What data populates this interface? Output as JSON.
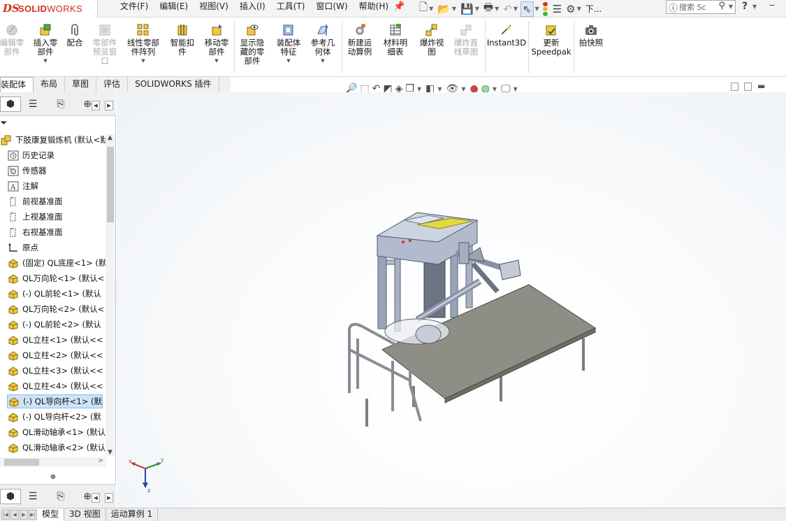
{
  "app": {
    "brand_ds": "DS",
    "brand_name_bold": "SOLID",
    "brand_name_light": "WORKS",
    "brand_color": "#d52b1e"
  },
  "menu": [
    "文件(F)",
    "编辑(E)",
    "视图(V)",
    "插入(I)",
    "工具(T)",
    "窗口(W)",
    "帮助(H)"
  ],
  "quick_access": {
    "search_placeholder": "搜索 Sc",
    "truncated_label": "下..."
  },
  "commands": [
    {
      "label": "编辑零\n部件",
      "disabled": true
    },
    {
      "label": "插入零\n部件",
      "disabled": false
    },
    {
      "label": "配合",
      "disabled": false
    },
    {
      "label": "零部件\n预览窗\n口",
      "disabled": true
    },
    {
      "label": "线性零部\n件阵列",
      "disabled": false
    },
    {
      "label": "智能扣\n件",
      "disabled": false
    },
    {
      "label": "移动零\n部件",
      "disabled": false
    },
    {
      "label": "显示隐\n藏的零\n部件",
      "disabled": false
    },
    {
      "label": "装配体\n特征",
      "disabled": false
    },
    {
      "label": "参考几\n何体",
      "disabled": false
    },
    {
      "label": "新建运\n动算例",
      "disabled": false
    },
    {
      "label": "材料明\n细表",
      "disabled": false
    },
    {
      "label": "爆炸视\n图",
      "disabled": false
    },
    {
      "label": "爆炸直\n线草图",
      "disabled": true
    },
    {
      "label": "Instant3D",
      "disabled": false
    },
    {
      "label": "更新\nSpeedpak",
      "disabled": false
    },
    {
      "label": "拍快照",
      "disabled": false
    }
  ],
  "command_tabs": [
    "装配体",
    "布局",
    "草图",
    "评估",
    "SOLIDWORKS 插件"
  ],
  "tree": {
    "root": "下肢康复锻炼机  (默认<默",
    "items": [
      {
        "label": "历史记录",
        "icon": "history-icon"
      },
      {
        "label": "传感器",
        "icon": "sensor-icon"
      },
      {
        "label": "注解",
        "icon": "annotation-icon"
      },
      {
        "label": "前视基准面",
        "icon": "plane-icon"
      },
      {
        "label": "上视基准面",
        "icon": "plane-icon"
      },
      {
        "label": "右视基准面",
        "icon": "plane-icon"
      },
      {
        "label": "原点",
        "icon": "origin-icon"
      },
      {
        "label": "(固定) QL底座<1>  (默",
        "icon": "part-icon"
      },
      {
        "label": "QL万向轮<1>  (默认<",
        "icon": "part-icon"
      },
      {
        "label": "(-) QL前轮<1>  (默认",
        "icon": "part-icon"
      },
      {
        "label": "QL万向轮<2>  (默认<",
        "icon": "part-icon"
      },
      {
        "label": "(-) QL前轮<2>  (默认",
        "icon": "part-icon"
      },
      {
        "label": "QL立柱<1>  (默认<<",
        "icon": "part-icon"
      },
      {
        "label": "QL立柱<2>  (默认<<",
        "icon": "part-icon"
      },
      {
        "label": "QL立柱<3>  (默认<<",
        "icon": "part-icon"
      },
      {
        "label": "QL立柱<4>  (默认<<",
        "icon": "part-icon"
      },
      {
        "label": "(-) QL导向杆<1>  (默",
        "icon": "part-icon",
        "selected": true
      },
      {
        "label": "(-) QL导向杆<2>  (默",
        "icon": "part-icon"
      },
      {
        "label": "QL滑动轴承<1>  (默认",
        "icon": "part-icon"
      },
      {
        "label": "QL滑动轴承<2>  (默认",
        "icon": "part-icon"
      }
    ]
  },
  "triad": {
    "x": "x",
    "y": "y",
    "z": "z"
  },
  "bottom_tabs": [
    "模型",
    "3D 视图",
    "运动算例 1"
  ]
}
